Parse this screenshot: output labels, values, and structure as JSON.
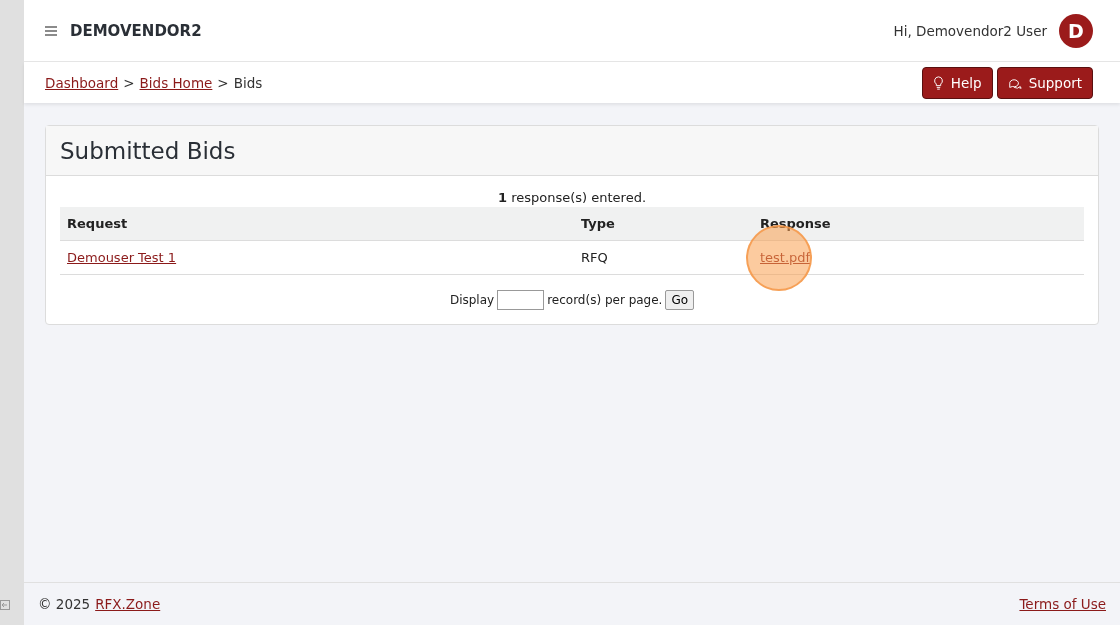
{
  "header": {
    "brand": "DEMOVENDOR2",
    "greeting": "Hi, Demovendor2 User",
    "avatar": "D"
  },
  "breadcrumbs": [
    {
      "label": "Dashboard",
      "kind": "link"
    },
    {
      "label": ">",
      "kind": "sep"
    },
    {
      "label": "Bids Home",
      "kind": "link"
    },
    {
      "label": ">",
      "kind": "sep"
    },
    {
      "label": "Bids",
      "kind": "current"
    }
  ],
  "buttons": [
    {
      "label": "Help",
      "kind": "help"
    },
    {
      "label": "Support",
      "kind": "support"
    }
  ],
  "card": {
    "title": "Submitted Bids",
    "summary": "**1** response(s) entered."
  },
  "table": {
    "columns": [
      "Request",
      "Type",
      "Response"
    ],
    "rows": [
      {
        "request": "Demouser Test 1",
        "type": "RFQ",
        "response": "test.pdf",
        "clicked": true
      }
    ]
  },
  "pager": {
    "before": "Display",
    "after": "record(s) per page.",
    "button": "Go"
  },
  "footer": {
    "copyright": "© 2025",
    "link": "RFX.Zone",
    "terms": "Terms of Use"
  }
}
